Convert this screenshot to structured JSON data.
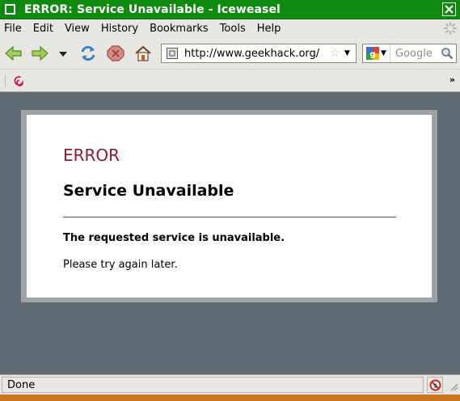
{
  "window": {
    "title": "ERROR: Service Unavailable - Iceweasel",
    "accent": "#0f8a0f"
  },
  "menu": {
    "items": [
      "File",
      "Edit",
      "View",
      "History",
      "Bookmarks",
      "Tools",
      "Help"
    ]
  },
  "toolbar": {
    "back_icon": "back-arrow-icon",
    "forward_icon": "forward-arrow-icon",
    "history_dropdown_icon": "dropdown-arrow-icon",
    "reload_icon": "reload-icon",
    "stop_icon": "stop-icon",
    "home_icon": "home-icon",
    "url": "http://www.geekhack.org/",
    "search_placeholder": "Google"
  },
  "bookmarks": {
    "items_icon": "debian-swirl-icon",
    "overflow": "»"
  },
  "page": {
    "error_title": "ERROR",
    "error_color": "#8a1d2e",
    "heading": "Service Unavailable",
    "message": "The requested service is unavailable.",
    "retry": "Please try again later."
  },
  "status": {
    "text": "Done"
  }
}
